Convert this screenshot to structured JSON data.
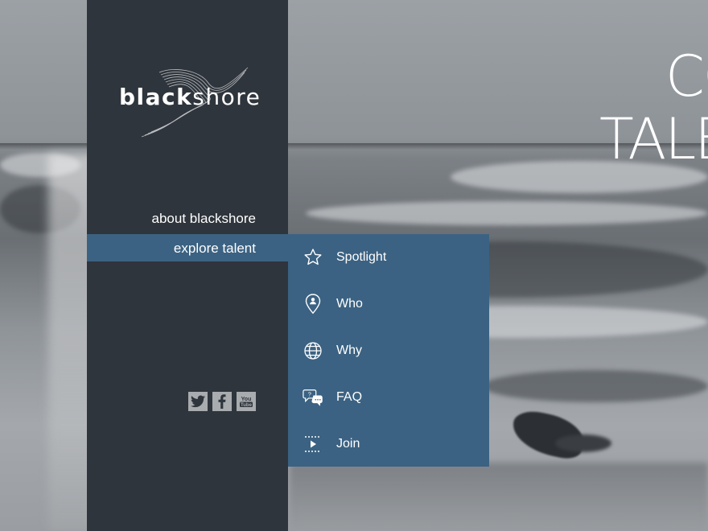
{
  "headline": {
    "line1": "CO",
    "line2": "TALE"
  },
  "sidebar": {
    "logo": {
      "part_bold": "black",
      "part_regular": "shore"
    },
    "nav": [
      {
        "label": "about blackshore",
        "active": false
      },
      {
        "label": "explore talent",
        "active": true
      }
    ],
    "social": [
      {
        "name": "twitter-icon"
      },
      {
        "name": "facebook-icon"
      },
      {
        "name": "youtube-icon"
      }
    ]
  },
  "submenu": {
    "items": [
      {
        "label": "Spotlight",
        "icon": "star-icon"
      },
      {
        "label": "Who",
        "icon": "person-pin-icon"
      },
      {
        "label": "Why",
        "icon": "globe-icon"
      },
      {
        "label": "FAQ",
        "icon": "chat-question-icon"
      },
      {
        "label": "Join",
        "icon": "play-icon"
      }
    ]
  },
  "colors": {
    "sidebar_bg": "#2f353c",
    "accent_blue": "#3b6282",
    "text": "#ffffff"
  }
}
